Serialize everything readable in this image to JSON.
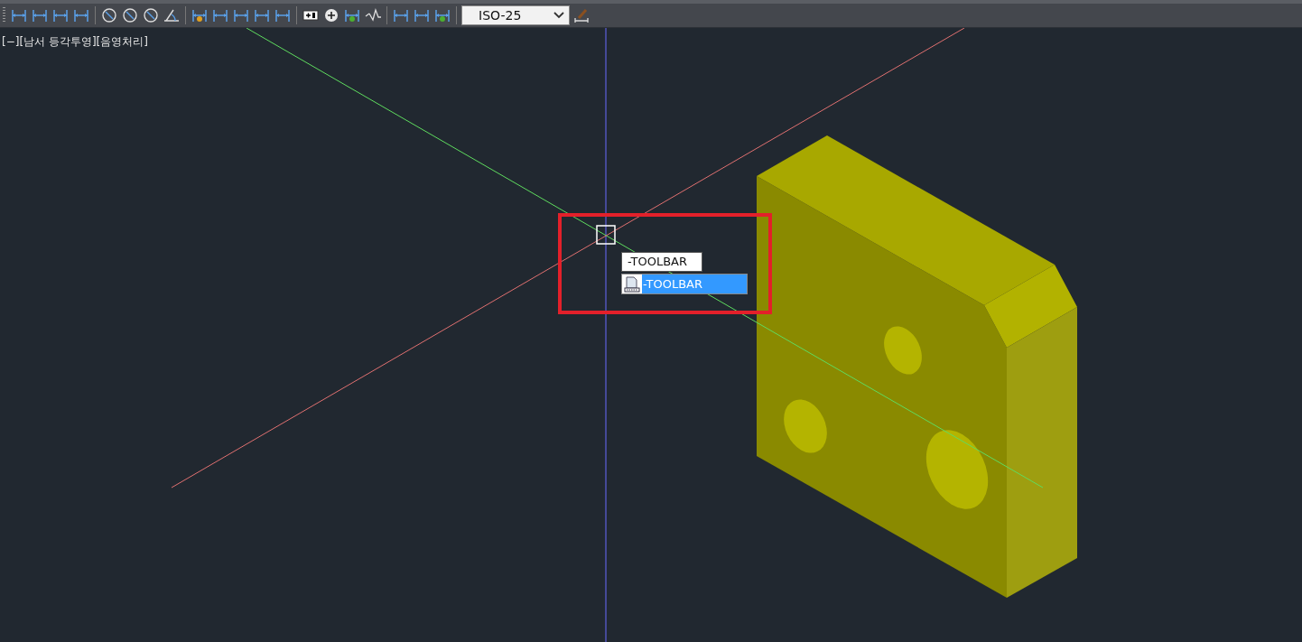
{
  "toolbar": {
    "dimension_style": {
      "value": "ISO-25"
    }
  },
  "viewport": {
    "label": "[−][남서 등각투영][음영처리]"
  },
  "command_input": {
    "value": "-TOOLBAR"
  },
  "suggestions": [
    {
      "label": "-TOOLBAR",
      "selected": true
    }
  ]
}
